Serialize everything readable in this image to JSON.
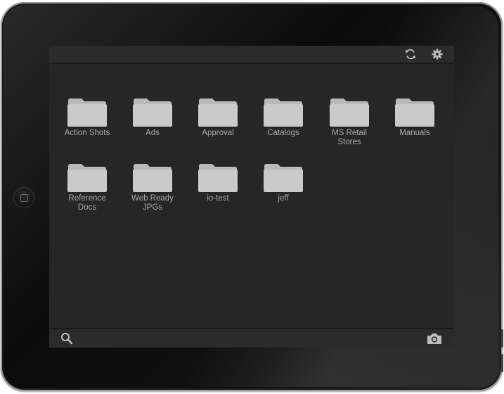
{
  "toolbar": {
    "refresh_icon": "refresh-icon",
    "settings_icon": "gear-icon"
  },
  "folders": [
    {
      "label": "Action Shots"
    },
    {
      "label": "Ads"
    },
    {
      "label": "Approval"
    },
    {
      "label": "Catalogs"
    },
    {
      "label": "MS Retail\nStores"
    },
    {
      "label": "Manuals"
    },
    {
      "label": "Reference\nDocs"
    },
    {
      "label": "Web Ready\nJPGs"
    },
    {
      "label": "io-test"
    },
    {
      "label": "jeff"
    }
  ],
  "bottombar": {
    "search_icon": "search-icon",
    "camera_icon": "camera-icon"
  },
  "colors": {
    "screen_bg": "#262626",
    "folder_fill": "#c9c9c9",
    "label_text": "#a8a8a8"
  }
}
